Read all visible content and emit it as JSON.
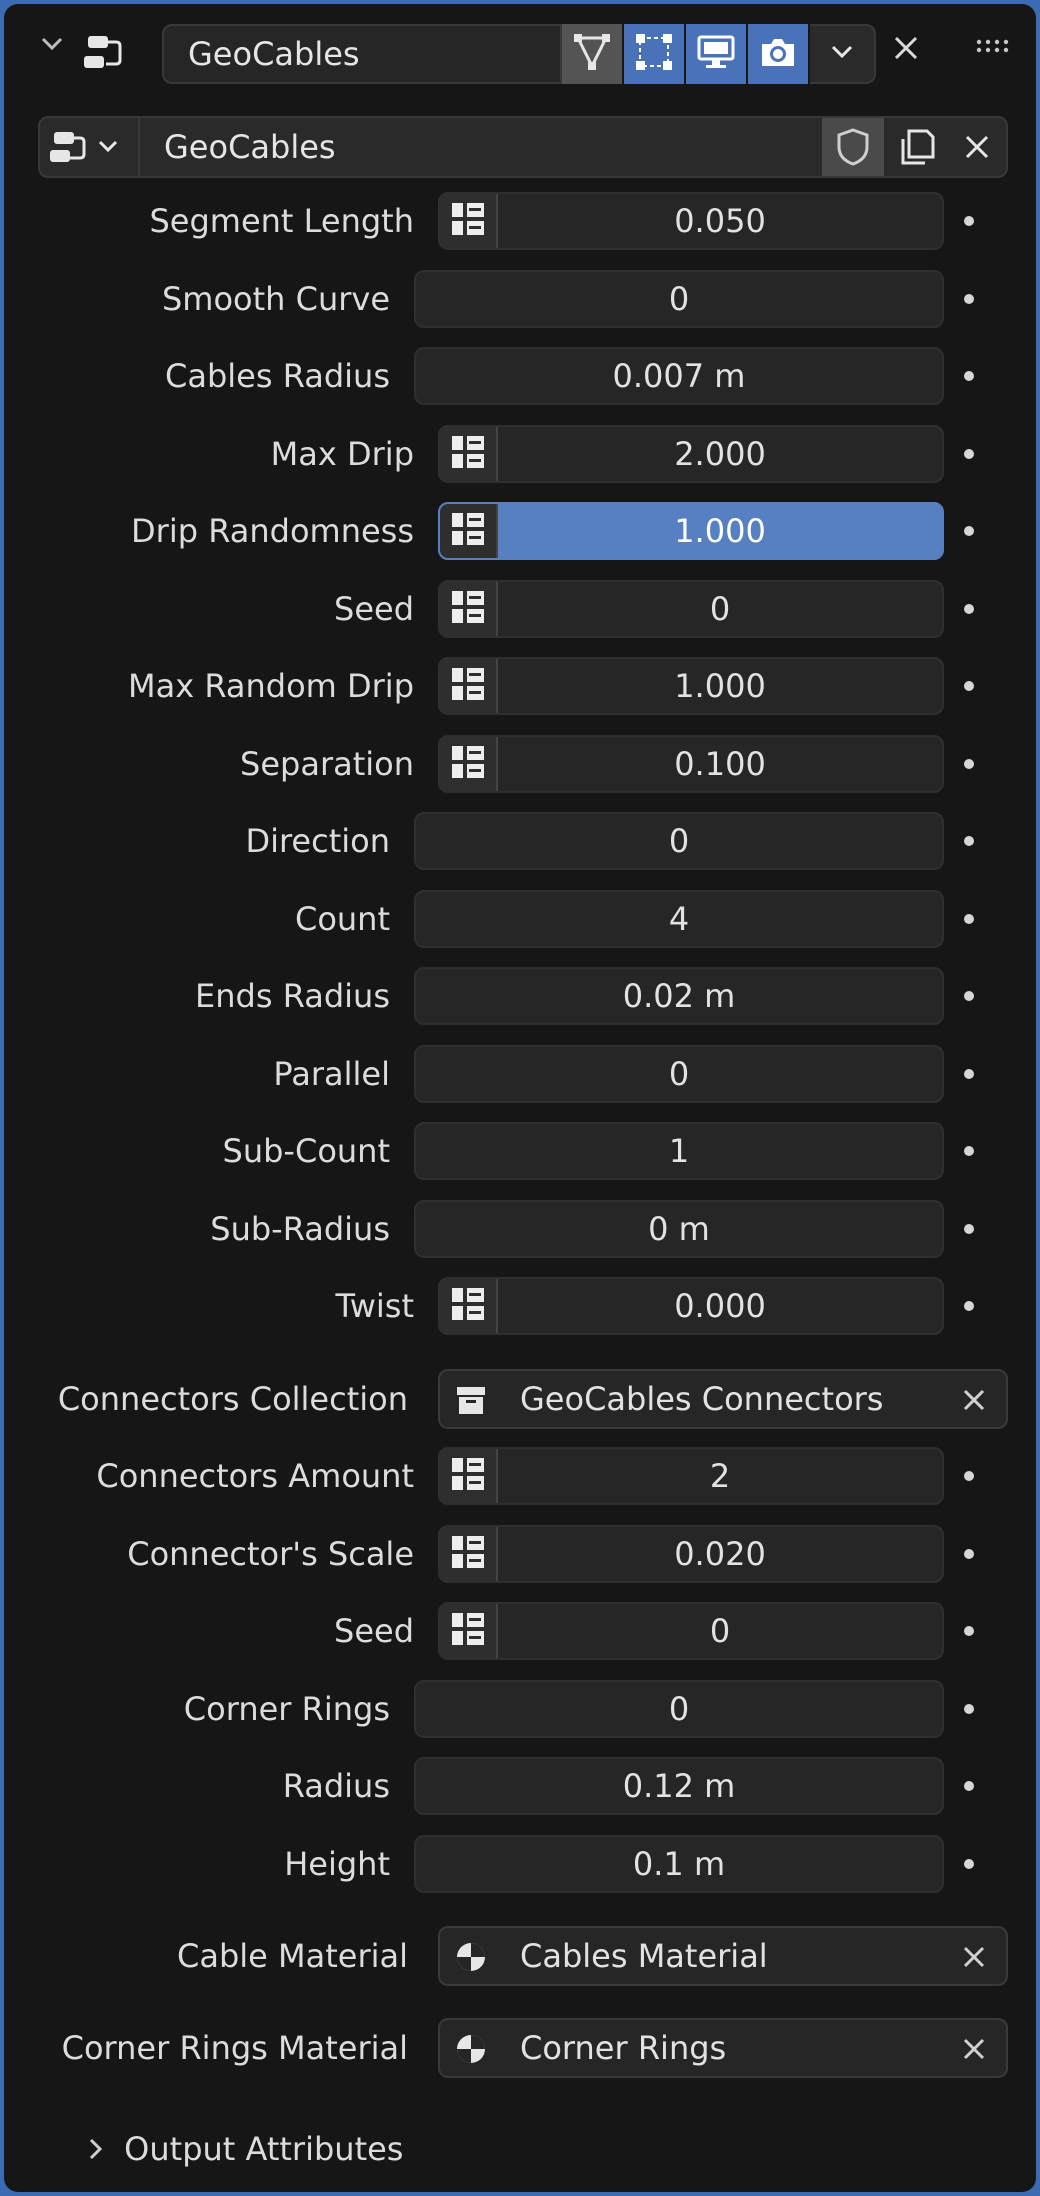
{
  "header": {
    "modifier_name": "GeoCables",
    "icons": [
      "collapse-chevron-icon",
      "geometry-nodes-modifier-icon",
      "edit-mode-icon",
      "on-cage-icon",
      "viewport-display-icon",
      "render-icon",
      "dropdown-chevron-icon",
      "close-icon",
      "drag-handle-icon"
    ]
  },
  "node_group": {
    "name": "GeoCables"
  },
  "properties": [
    {
      "label": "Segment Length",
      "value": "0.050",
      "attr": true
    },
    {
      "label": "Smooth Curve",
      "value": "0",
      "attr": false
    },
    {
      "label": "Cables Radius",
      "value": "0.007 m",
      "attr": false
    },
    {
      "label": "Max Drip",
      "value": "2.000",
      "attr": true
    },
    {
      "label": "Drip Randomness",
      "value": "1.000",
      "attr": true,
      "highlight": true
    },
    {
      "label": "Seed",
      "value": "0",
      "attr": true
    },
    {
      "label": "Max Random Drip",
      "value": "1.000",
      "attr": true
    },
    {
      "label": "Separation",
      "value": "0.100",
      "attr": true
    },
    {
      "label": "Direction",
      "value": "0",
      "attr": false
    },
    {
      "label": "Count",
      "value": "4",
      "attr": false
    },
    {
      "label": "Ends Radius",
      "value": "0.02 m",
      "attr": false
    },
    {
      "label": "Parallel",
      "value": "0",
      "attr": false
    },
    {
      "label": "Sub-Count",
      "value": "1",
      "attr": false
    },
    {
      "label": "Sub-Radius",
      "value": "0 m",
      "attr": false
    },
    {
      "label": "Twist",
      "value": "0.000",
      "attr": true
    }
  ],
  "connectors_collection": {
    "label": "Connectors Collection",
    "value": "GeoCables Connectors"
  },
  "properties2": [
    {
      "label": "Connectors Amount",
      "value": "2",
      "attr": true
    },
    {
      "label": "Connector's Scale",
      "value": "0.020",
      "attr": true
    },
    {
      "label": "Seed",
      "value": "0",
      "attr": true
    },
    {
      "label": "Corner Rings",
      "value": "0",
      "attr": false
    },
    {
      "label": "Radius",
      "value": "0.12 m",
      "attr": false
    },
    {
      "label": "Height",
      "value": "0.1 m",
      "attr": false
    }
  ],
  "materials": [
    {
      "label": "Cable Material",
      "value": "Cables Material"
    },
    {
      "label": "Corner Rings Material",
      "value": "Corner Rings"
    }
  ],
  "output_panel": {
    "label": "Output Attributes"
  },
  "colors": {
    "accent": "#5680c2",
    "background": "#161616",
    "field": "#262626",
    "frame": "#3d6bb3"
  }
}
